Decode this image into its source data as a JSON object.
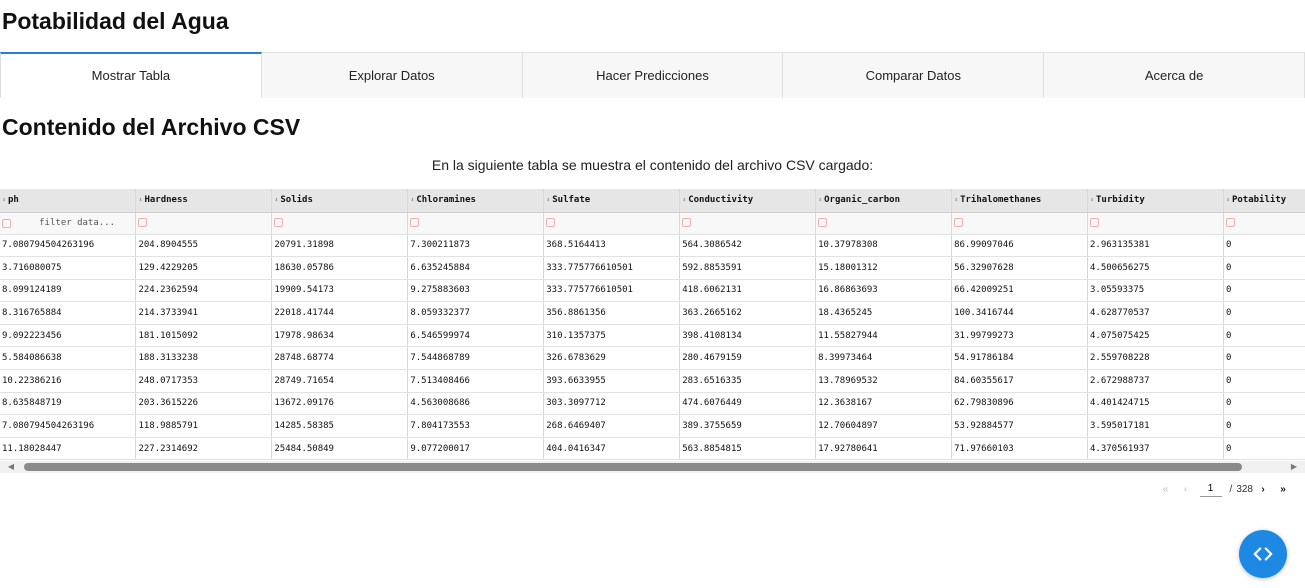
{
  "app": {
    "title": "Potabilidad del Agua"
  },
  "tabs": [
    {
      "label": "Mostrar Tabla",
      "active": true
    },
    {
      "label": "Explorar Datos",
      "active": false
    },
    {
      "label": "Hacer Predicciones",
      "active": false
    },
    {
      "label": "Comparar Datos",
      "active": false
    },
    {
      "label": "Acerca de",
      "active": false
    }
  ],
  "main": {
    "title": "Contenido del Archivo CSV",
    "subtitle": "En la siguiente tabla se muestra el contenido del archivo CSV cargado:"
  },
  "table": {
    "columns": [
      "ph",
      "Hardness",
      "Solids",
      "Chloramines",
      "Sulfate",
      "Conductivity",
      "Organic_carbon",
      "Trihalomethanes",
      "Turbidity",
      "Potability"
    ],
    "filter_placeholder": "filter data...",
    "rows": [
      [
        "7.080794504263196",
        "204.8904555",
        "20791.31898",
        "7.300211873",
        "368.5164413",
        "564.3086542",
        "10.37978308",
        "86.99097046",
        "2.963135381",
        "0"
      ],
      [
        "3.716080075",
        "129.4229205",
        "18630.05786",
        "6.635245884",
        "333.775776610501",
        "592.8853591",
        "15.18001312",
        "56.32907628",
        "4.500656275",
        "0"
      ],
      [
        "8.099124189",
        "224.2362594",
        "19909.54173",
        "9.275883603",
        "333.775776610501",
        "418.6062131",
        "16.86863693",
        "66.42009251",
        "3.05593375",
        "0"
      ],
      [
        "8.316765884",
        "214.3733941",
        "22018.41744",
        "8.059332377",
        "356.8861356",
        "363.2665162",
        "18.4365245",
        "100.3416744",
        "4.628770537",
        "0"
      ],
      [
        "9.092223456",
        "181.1015092",
        "17978.98634",
        "6.546599974",
        "310.1357375",
        "398.4108134",
        "11.55827944",
        "31.99799273",
        "4.075075425",
        "0"
      ],
      [
        "5.584086638",
        "188.3133238",
        "28748.68774",
        "7.544868789",
        "326.6783629",
        "280.4679159",
        "8.39973464",
        "54.91786184",
        "2.559708228",
        "0"
      ],
      [
        "10.22386216",
        "248.0717353",
        "28749.71654",
        "7.513408466",
        "393.6633955",
        "283.6516335",
        "13.78969532",
        "84.60355617",
        "2.672988737",
        "0"
      ],
      [
        "8.635848719",
        "203.3615226",
        "13672.09176",
        "4.563008686",
        "303.3097712",
        "474.6076449",
        "12.3638167",
        "62.79830896",
        "4.401424715",
        "0"
      ],
      [
        "7.080794504263196",
        "118.9885791",
        "14285.58385",
        "7.804173553",
        "268.6469407",
        "389.3755659",
        "12.70604897",
        "53.92884577",
        "3.595017181",
        "0"
      ],
      [
        "11.18028447",
        "227.2314692",
        "25484.50849",
        "9.077200017",
        "404.0416347",
        "563.8854815",
        "17.92780641",
        "71.97660103",
        "4.370561937",
        "0"
      ]
    ]
  },
  "pagination": {
    "current_page": "1",
    "separator": "/",
    "total_pages": "328",
    "first_icon": "«",
    "prev_icon": "‹",
    "next_icon": "›",
    "last_icon": "»"
  },
  "icons": {
    "sort": "sort-icon",
    "filter": "filter-icon",
    "fab": "code-icon"
  },
  "colors": {
    "accent": "#2b7cd3",
    "fab": "#1e88e5"
  }
}
